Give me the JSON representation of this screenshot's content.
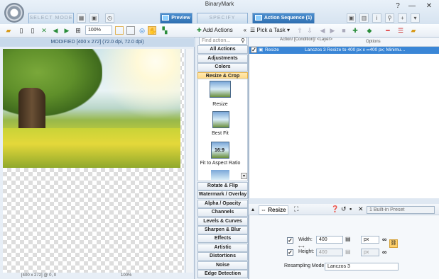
{
  "app": {
    "title": "BinaryMark"
  },
  "window": {
    "help_label": "?",
    "minimize_label": "—",
    "close_label": "✕"
  },
  "tabs": {
    "select_mode": "SELECT MODE",
    "preview": "Preview",
    "specify_actions": "SPECIFY ACTIONS",
    "action_sequence": "Action Sequence (1)"
  },
  "toolbar": {
    "zoom": "100%"
  },
  "left": {
    "modified_label": "MODIFIED [400 x 272] (72.0 dpi, 72.0 dpi)",
    "status": "[400 x 272] @ 0, 0",
    "zoom_status": "100%"
  },
  "middle": {
    "add_actions": "Add Actions",
    "collapse": "«",
    "search_placeholder": "Find action...",
    "categories_top": [
      "All Actions",
      "Adjustments",
      "Colors",
      "Resize & Crop"
    ],
    "actions": [
      "Resize",
      "Best Fit",
      "Fit to Aspect Ratio"
    ],
    "aspect_badge": "16:9",
    "categories_bottom": [
      "Rotate & Flip",
      "Watermark / Overlay",
      "Alpha / Opacity",
      "Channels",
      "Levels & Curves",
      "Sharpen & Blur",
      "Effects",
      "Artistic",
      "Distortions",
      "Noise",
      "Edge Detection"
    ]
  },
  "right": {
    "pick_task": "Pick a Task",
    "grid_header_action": "Action/ [Condition]/ <Layer>",
    "grid_header_options": "Options",
    "row_action": "Resize",
    "row_options": "Lanczos 3 Resize to 400 px x ∞400 px; Minimu…",
    "resize_tab": "Resize",
    "preset": "1 Built-in Preset",
    "width_label": "Width:",
    "width_value": "400",
    "height_label": "Height:",
    "height_value": "400",
    "unit": "px",
    "resampling_label": "Resampling Mode:",
    "resampling_value": "Lanczos 3"
  },
  "colors": {
    "accent": "#2f6fb0",
    "selected_category": "#ffd57a",
    "selected_row": "#3a86d6"
  }
}
